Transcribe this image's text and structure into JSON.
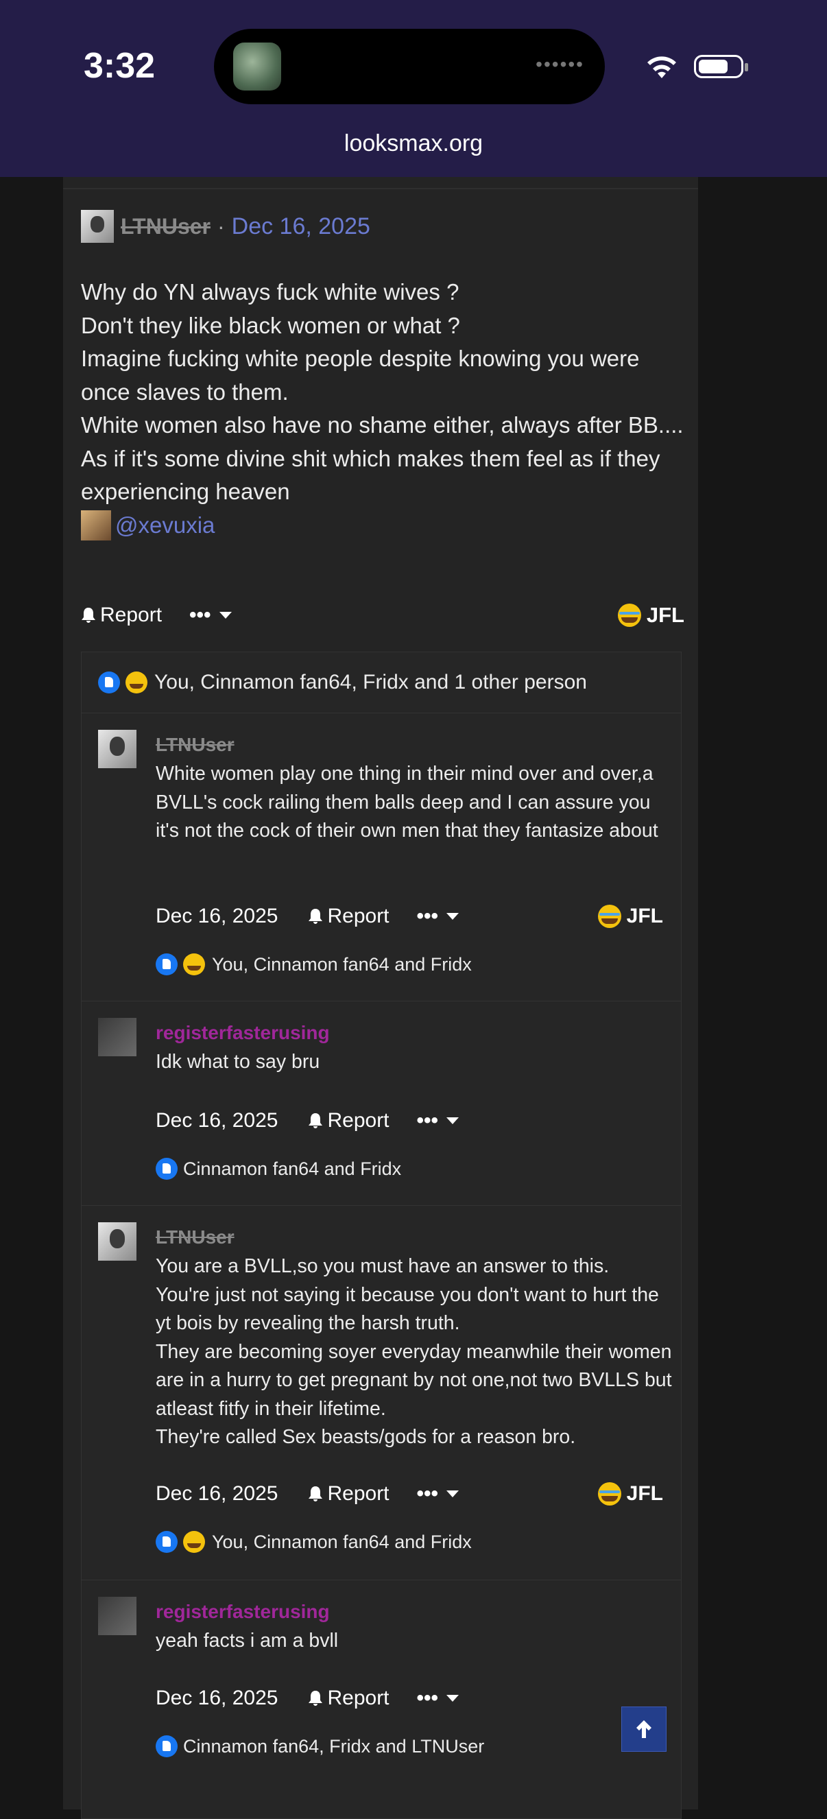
{
  "status_bar": {
    "time": "3:32",
    "url": "looksmax.org"
  },
  "post": {
    "author": "LTNUser",
    "separator": "·",
    "date": "Dec 16, 2025",
    "body": [
      "Why do YN always fuck white wives ?",
      "Don't they like black women or what ?",
      "Imagine fucking white people despite knowing you were once slaves to them.",
      "White women also have no shame either, always after BB....",
      "As if it's some divine shit which makes them feel as if they experiencing heaven"
    ],
    "mention": "@xevuxia",
    "report_label": "Report",
    "more_label": "•••",
    "jfl_label": "JFL",
    "reactions_summary": "You, Cinnamon fan64, Fridx and 1 other person"
  },
  "replies": [
    {
      "author": "LTNUser",
      "struck": true,
      "text": [
        "White women play one thing in their mind over and over,a BVLL's cock railing them balls deep and I can assure you it's not the cock of their own men that they fantasize about"
      ],
      "date": "Dec 16, 2025",
      "report_label": "Report",
      "more_label": "•••",
      "jfl_label": "JFL",
      "reactions": "You, Cinnamon fan64 and Fridx"
    },
    {
      "author": "registerfasterusing",
      "struck": false,
      "text": [
        "Idk what to say bru"
      ],
      "date": "Dec 16, 2025",
      "report_label": "Report",
      "more_label": "•••",
      "reactions": "Cinnamon fan64 and Fridx"
    },
    {
      "author": "LTNUser",
      "struck": true,
      "text": [
        "You are a BVLL,so you must have an answer to this.",
        "You're just not saying it because you don't want to hurt the yt bois by revealing the harsh truth.",
        "They are becoming soyer everyday meanwhile their women are in a hurry to get pregnant by not one,not two BVLLS but atleast fitfy in their lifetime.",
        "They're called Sex beasts/gods for a reason bro."
      ],
      "date": "Dec 16, 2025",
      "report_label": "Report",
      "more_label": "•••",
      "jfl_label": "JFL",
      "reactions": "You, Cinnamon fan64 and Fridx"
    },
    {
      "author": "registerfasterusing",
      "struck": false,
      "text": [
        "yeah facts i am a bvll"
      ],
      "date": "Dec 16, 2025",
      "report_label": "Report",
      "more_label": "•••",
      "reactions": "Cinnamon fan64, Fridx and LTNUser"
    }
  ],
  "colors": {
    "status_bar_bg": "#241d48",
    "link": "#6b7bd1",
    "username_purple": "#a0279a",
    "scroll_button": "#233e8b"
  }
}
